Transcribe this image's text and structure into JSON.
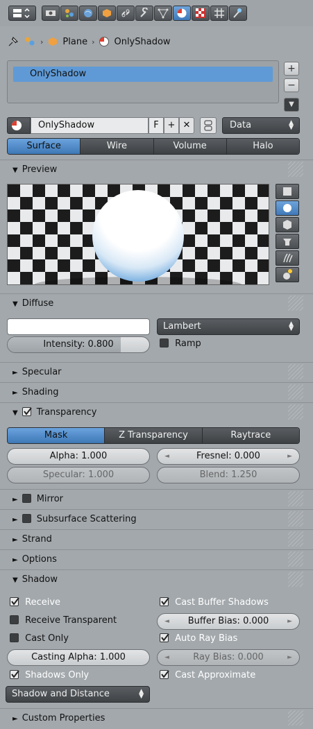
{
  "header": {
    "tabs": [
      {
        "icon": "render-layers-icon"
      },
      {
        "icon": "camera-icon"
      },
      {
        "icon": "scene-icon"
      },
      {
        "icon": "world-icon"
      },
      {
        "icon": "object-icon"
      },
      {
        "icon": "constraint-icon"
      },
      {
        "icon": "modifier-icon"
      },
      {
        "icon": "mesh-data-icon"
      },
      {
        "icon": "material-icon",
        "active": true
      },
      {
        "icon": "texture-icon"
      },
      {
        "icon": "particles-icon"
      },
      {
        "icon": "physics-icon"
      }
    ]
  },
  "breadcrumb": {
    "object": "Plane",
    "material": "OnlyShadow"
  },
  "slots": {
    "items": [
      "OnlyShadow"
    ]
  },
  "material": {
    "name": "OnlyShadow",
    "fake_user": "F",
    "link_mode": "Data"
  },
  "type_tabs": [
    "Surface",
    "Wire",
    "Volume",
    "Halo"
  ],
  "panels": {
    "preview": "Preview",
    "diffuse": "Diffuse",
    "specular": "Specular",
    "shading": "Shading",
    "transparency": "Transparency",
    "mirror": "Mirror",
    "sss": "Subsurface Scattering",
    "strand": "Strand",
    "options": "Options",
    "shadow": "Shadow",
    "custom": "Custom Properties"
  },
  "diffuse": {
    "shader": "Lambert",
    "intensity": "Intensity: 0.800",
    "intensity_value": 0.8,
    "ramp": "Ramp"
  },
  "transparency": {
    "modes": [
      "Mask",
      "Z Transparency",
      "Raytrace"
    ],
    "alpha": "Alpha: 1.000",
    "fresnel": "Fresnel: 0.000",
    "specular": "Specular: 1.000",
    "blend": "Blend: 1.250"
  },
  "shadow": {
    "receive": "Receive",
    "receive_transparent": "Receive Transparent",
    "cast_only": "Cast Only",
    "casting_alpha": "Casting Alpha: 1.000",
    "shadows_only": "Shadows Only",
    "shadow_mode": "Shadow and Distance",
    "cast_buffer": "Cast Buffer Shadows",
    "buffer_bias": "Buffer Bias: 0.000",
    "auto_ray_bias": "Auto Ray Bias",
    "ray_bias": "Ray Bias: 0.000",
    "cast_approx": "Cast Approximate"
  },
  "colors": {
    "accent": "#5f9ad6",
    "panel": "#a3a8ac",
    "dark_button": "#43474a"
  }
}
